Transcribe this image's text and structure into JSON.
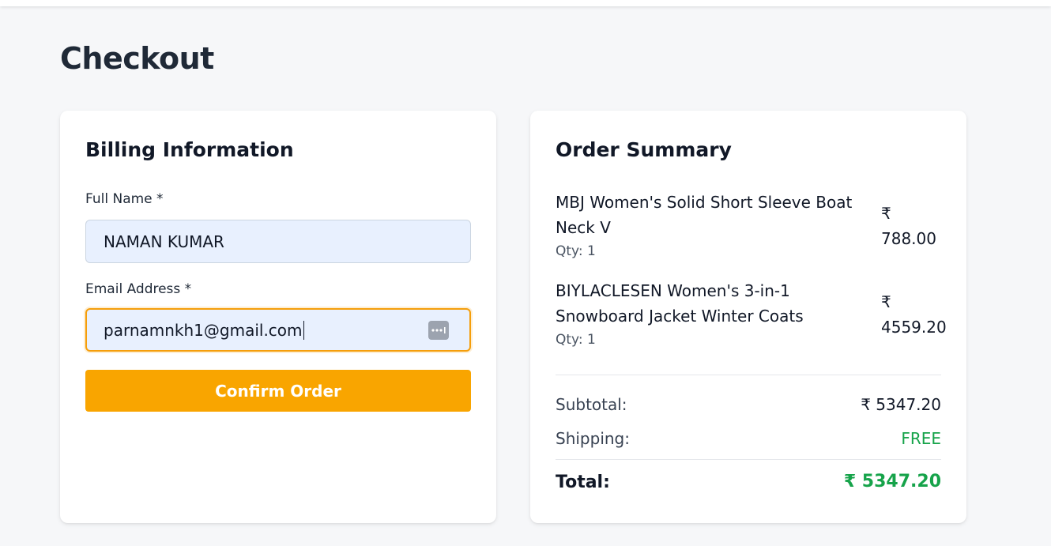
{
  "page": {
    "title": "Checkout"
  },
  "billing": {
    "title": "Billing Information",
    "full_name_label": "Full Name *",
    "full_name_value": "NAMAN KUMAR",
    "email_label": "Email Address *",
    "email_value": "parnamnkh1@gmail.com",
    "email_autofill_icon": "password-manager-icon",
    "confirm_label": "Confirm Order"
  },
  "summary": {
    "title": "Order Summary",
    "items": [
      {
        "name": "MBJ Women's Solid Short Sleeve Boat Neck V",
        "qty": "Qty: 1",
        "price": "₹ 788.00"
      },
      {
        "name": "BIYLACLESEN Women's 3-in-1 Snowboard Jacket Winter Coats",
        "qty": "Qty: 1",
        "price": "₹ 4559.20"
      }
    ],
    "subtotal_label": "Subtotal:",
    "subtotal_value": "₹ 5347.20",
    "shipping_label": "Shipping:",
    "shipping_value": "FREE",
    "total_label": "Total:",
    "total_value": "₹ 5347.20"
  },
  "colors": {
    "accent": "#f9a500",
    "success": "#16a34a",
    "field_bg": "#e8f0fe"
  }
}
